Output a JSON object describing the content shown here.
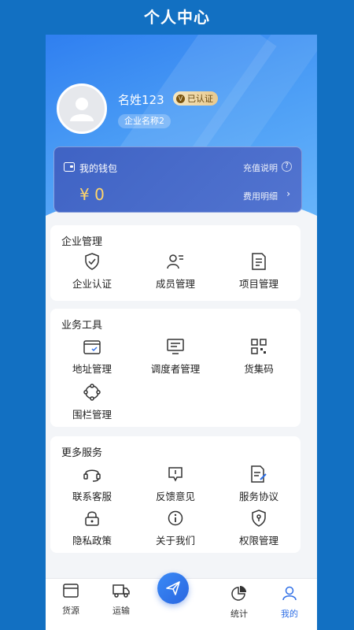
{
  "page_title": "个人中心",
  "profile": {
    "name": "名姓123",
    "verified_label": "已认证",
    "verified_mark": "V",
    "company": "企业名称2"
  },
  "wallet": {
    "title": "我的钱包",
    "recharge_info": "充值说明",
    "help_glyph": "?",
    "balance": "¥ 0",
    "fee_details": "费用明细",
    "chevron": "›"
  },
  "enterprise": {
    "title": "企业管理",
    "items": [
      {
        "label": "企业认证",
        "icon": "shield-check-icon"
      },
      {
        "label": "成员管理",
        "icon": "members-icon"
      },
      {
        "label": "项目管理",
        "icon": "document-icon"
      }
    ]
  },
  "tools": {
    "title": "业务工具",
    "items": [
      {
        "label": "地址管理",
        "icon": "address-card-icon"
      },
      {
        "label": "调度者管理",
        "icon": "monitor-icon"
      },
      {
        "label": "货集码",
        "icon": "qr-code-icon"
      },
      {
        "label": "围栏管理",
        "icon": "fence-icon"
      }
    ]
  },
  "services": {
    "title": "更多服务",
    "items": [
      {
        "label": "联系客服",
        "icon": "headset-icon"
      },
      {
        "label": "反馈意见",
        "icon": "feedback-icon"
      },
      {
        "label": "服务协议",
        "icon": "agreement-icon"
      },
      {
        "label": "隐私政策",
        "icon": "lock-icon"
      },
      {
        "label": "关于我们",
        "icon": "info-icon"
      },
      {
        "label": "权限管理",
        "icon": "permission-shield-icon"
      }
    ]
  },
  "tabbar": {
    "items": [
      {
        "label": "货源",
        "icon": "cargo-box-icon"
      },
      {
        "label": "运输",
        "icon": "truck-icon"
      },
      {
        "label": "",
        "icon": "send-plane-icon"
      },
      {
        "label": "统计",
        "icon": "pie-chart-icon"
      },
      {
        "label": "我的",
        "icon": "user-icon",
        "active": true
      }
    ]
  },
  "colors": {
    "background": "#1270c2",
    "accent": "#2f6fe6",
    "balance": "#ffd56a"
  }
}
